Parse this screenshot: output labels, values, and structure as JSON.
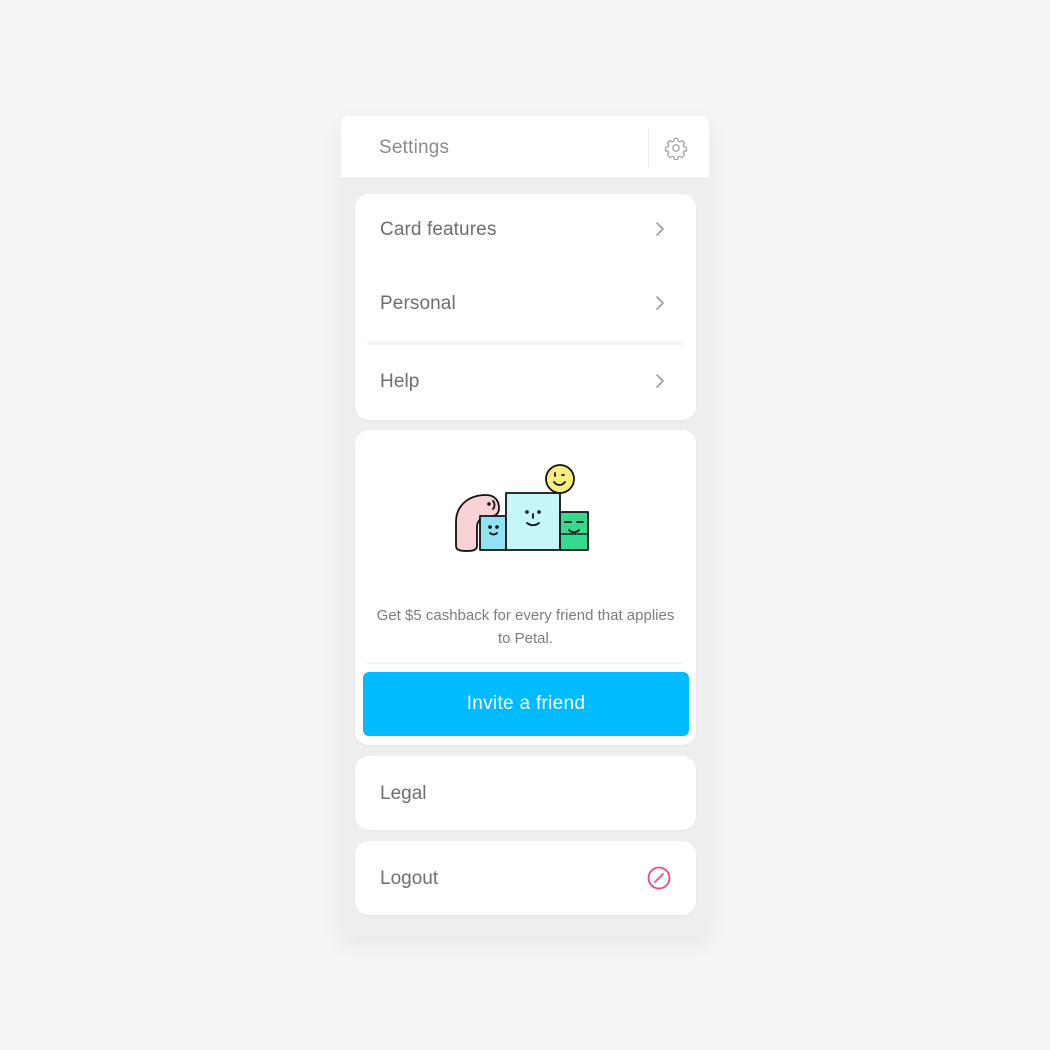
{
  "header": {
    "title": "Settings",
    "settings_icon": "gear-icon"
  },
  "menu": {
    "items": [
      {
        "label": "Card features",
        "icon": "chevron-right-icon"
      },
      {
        "label": "Personal",
        "icon": "chevron-right-icon"
      },
      {
        "label": "Help",
        "icon": "chevron-right-icon"
      }
    ]
  },
  "promo": {
    "illustration": "friends-illustration",
    "text": "Get $5 cashback for every friend that applies to Petal.",
    "button_label": "Invite a friend"
  },
  "legal": {
    "label": "Legal"
  },
  "logout": {
    "label": "Logout",
    "icon": "logout-icon"
  },
  "colors": {
    "background": "#f6f5f4",
    "accent": "#00bbff",
    "logout_icon": "#f0497a",
    "text": "#6f6f73"
  }
}
